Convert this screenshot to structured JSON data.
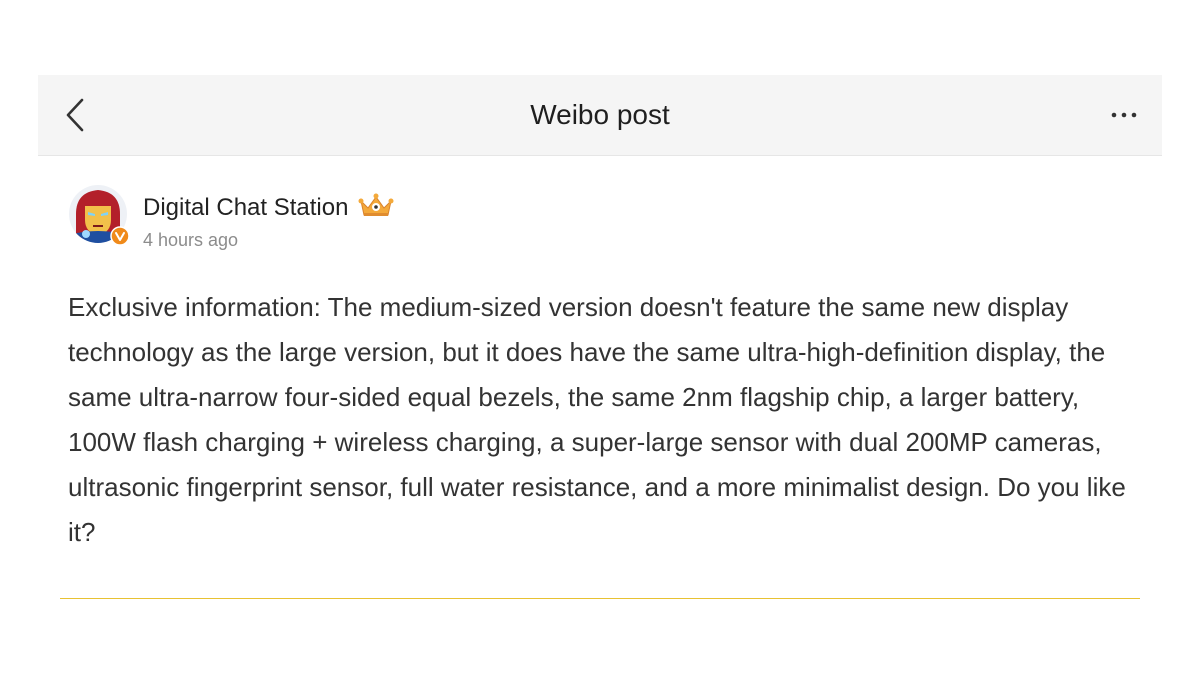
{
  "navbar": {
    "title": "Weibo post",
    "back_icon": "chevron-left-icon",
    "more_icon": "more-dots-icon"
  },
  "post": {
    "author": {
      "name": "Digital Chat Station",
      "avatar_icon": "iron-man-avatar",
      "verified_badge_icon": "verified-v-icon",
      "badge_icon": "crown-icon"
    },
    "timestamp": "4 hours ago",
    "text": "Exclusive information: The medium-sized version doesn't feature the same new display technology as the large version, but it does have the same ultra-high-definition display, the same ultra-narrow four-sided equal bezels, the same 2nm flagship chip, a larger battery, 100W flash charging + wireless charging, a super-large sensor with dual 200MP cameras, ultrasonic fingerprint sensor, full water resistance, and a more minimalist design. Do you like it?"
  },
  "colors": {
    "navbar_bg": "#f5f5f5",
    "text_primary": "#333333",
    "text_secondary": "#8c8c8c",
    "accent_divider": "#e8c233",
    "verified_badge": "#f08a1a"
  }
}
